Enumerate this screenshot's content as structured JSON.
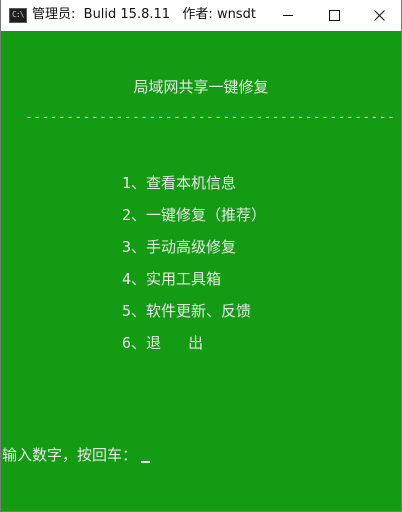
{
  "window": {
    "title": "管理员:  Bulid 15.8.11   作者: wnsdt",
    "icon": "console-icon",
    "controls": [
      "minimize-icon",
      "maximize-icon",
      "close-icon"
    ]
  },
  "console": {
    "heading": "局域网共享一键修复",
    "divider": "---------------------------------------------",
    "menu": [
      "1、查看本机信息",
      "2、一键修复（推荐）",
      "3、手动高级修复",
      "4、实用工具箱",
      "5、软件更新、反馈",
      "6、退   出"
    ],
    "prompt": "输入数字，按回车："
  },
  "colors": {
    "console_background": "#149b14",
    "console_text": "#e8e8e8",
    "titlebar_background": "#ffffff"
  }
}
